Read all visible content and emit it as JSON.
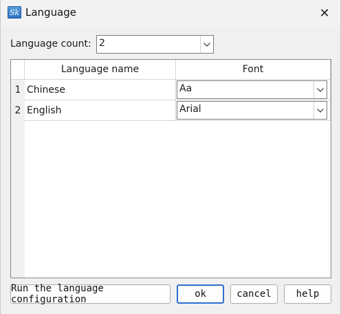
{
  "window": {
    "title": "Language",
    "close_glyph": "✕",
    "app_icon_text": "Sk"
  },
  "language_count": {
    "label": "Language count:",
    "value": "2"
  },
  "table": {
    "columns": [
      "Language name",
      "Font"
    ],
    "rows": [
      {
        "num": "1",
        "language": "Chinese",
        "font": "Aa"
      },
      {
        "num": "2",
        "language": "English",
        "font": "Arial"
      }
    ]
  },
  "buttons": {
    "run_config": "Run the language configuration",
    "ok": "ok",
    "cancel": "cancel",
    "help": "help"
  },
  "colors": {
    "default_button_border": "#2b6fd0",
    "window_bg": "#f0f0f0"
  }
}
